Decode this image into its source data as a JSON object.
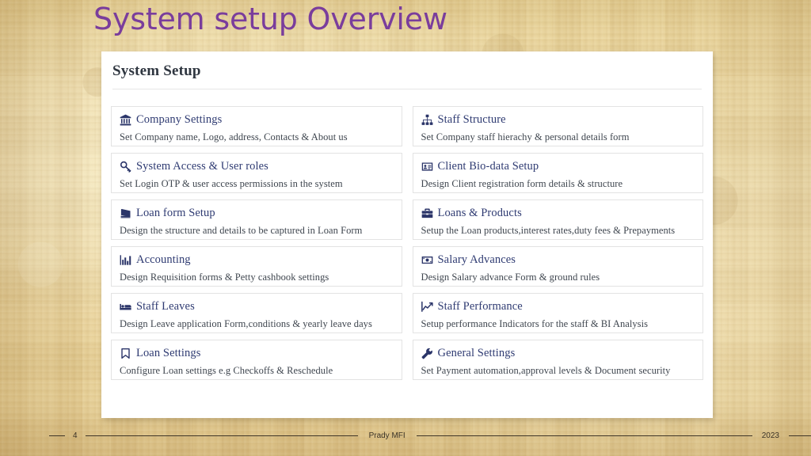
{
  "slide": {
    "title": "System setup Overview",
    "title_color": "#7a3d9c",
    "background": "papyrus-texture"
  },
  "panel": {
    "heading": "System Setup",
    "accent_color": "#2f3b72"
  },
  "cards": {
    "left_column": [
      {
        "icon": "bank-icon",
        "title": "Company Settings",
        "description": "Set Company name, Logo, address, Contacts & About us"
      },
      {
        "icon": "key-icon",
        "title": "System Access & User roles",
        "description": "Set Login OTP & user access permissions in the system"
      },
      {
        "icon": "book-icon",
        "title": "Loan form Setup",
        "description": "Design the structure and details to be captured in Loan Form"
      },
      {
        "icon": "bar-chart-icon",
        "title": "Accounting",
        "description": "Design Requisition forms & Petty cashbook settings"
      },
      {
        "icon": "bed-icon",
        "title": "Staff Leaves",
        "description": "Design Leave application Form,conditions & yearly leave days"
      },
      {
        "icon": "bookmark-icon",
        "title": "Loan Settings",
        "description": "Configure Loan settings e.g Checkoffs & Reschedule"
      }
    ],
    "right_column": [
      {
        "icon": "sitemap-icon",
        "title": "Staff Structure",
        "description": "Set Company staff hierachy & personal details form"
      },
      {
        "icon": "id-card-icon",
        "title": "Client Bio-data Setup",
        "description": "Design Client registration form details & structure"
      },
      {
        "icon": "briefcase-icon",
        "title": "Loans & Products",
        "description": "Setup the Loan products,interest rates,duty fees & Prepayments"
      },
      {
        "icon": "money-bill-icon",
        "title": "Salary Advances",
        "description": "Design Salary advance Form & ground rules"
      },
      {
        "icon": "line-chart-icon",
        "title": "Staff Performance",
        "description": "Setup performance Indicators for the staff & BI Analysis"
      },
      {
        "icon": "wrench-icon",
        "title": "General Settings",
        "description": "Set Payment automation,approval levels & Document security"
      }
    ]
  },
  "footer": {
    "page_number": "4",
    "center_text": "Prady MFI",
    "year": "2023"
  }
}
